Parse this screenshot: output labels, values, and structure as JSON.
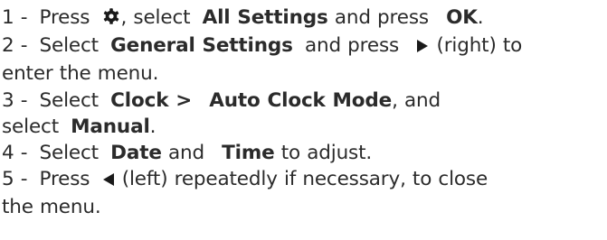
{
  "steps": [
    {
      "num": "1 -",
      "press": "Press",
      "after_icon": ", select",
      "all_settings": "All Settings",
      "and_press": "and press",
      "ok": "OK",
      "dot": "."
    },
    {
      "num": "2 -",
      "select": "Select",
      "general_settings": "General Settings",
      "and_press": "and press",
      "right_text": "(right) to",
      "cont": "enter the menu."
    },
    {
      "num": "3 -",
      "select": "Select",
      "clock": "Clock >",
      "auto_clock_mode": "Auto Clock Mode",
      "and_text": ", and",
      "select2": "select",
      "manual": "Manual",
      "dot": "."
    },
    {
      "num": "4 -",
      "select": "Select",
      "date": "Date",
      "and_text": "and",
      "time": "Time",
      "to_adjust": "to adjust."
    },
    {
      "num": "5 -",
      "press": "Press",
      "left_text": "(left) repeatedly if necessary, to close",
      "cont": "the menu."
    }
  ],
  "icons": {
    "settings": "gear-icon",
    "right": "triangle-right-icon",
    "left": "triangle-left-icon"
  },
  "colors": {
    "text": "#2b2b2b",
    "icon": "#1a1a1a"
  }
}
